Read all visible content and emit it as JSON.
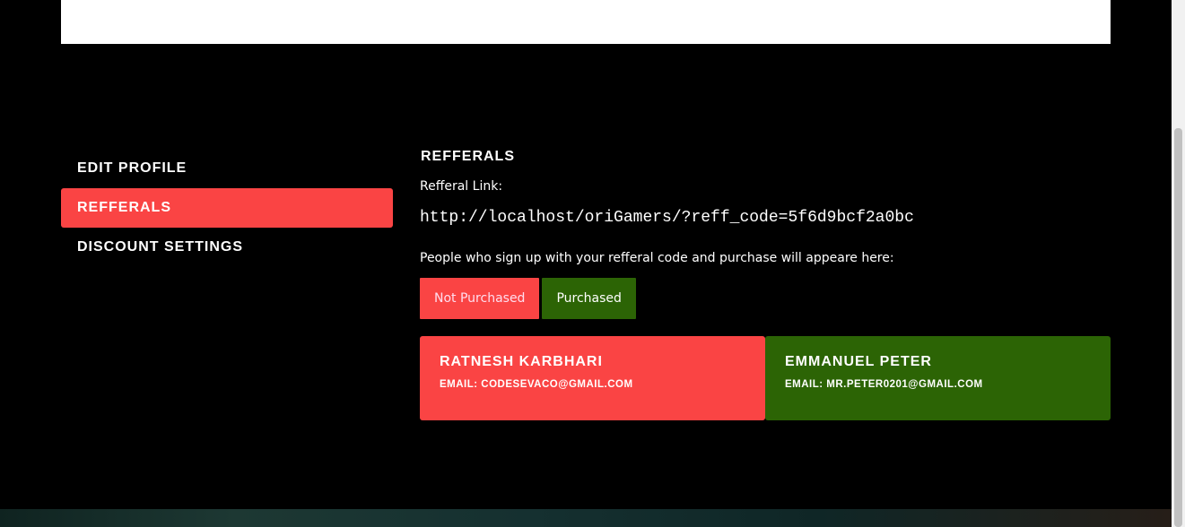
{
  "side_nav": {
    "items": [
      {
        "label": "Edit Profile"
      },
      {
        "label": "Refferals"
      },
      {
        "label": "Discount Settings"
      }
    ],
    "active_index": 1
  },
  "content": {
    "title": "Refferals",
    "referral_link_label": "Refferal Link:",
    "referral_link": "http://localhost/oriGamers/?reff_code=5f6d9bcf2a0bc",
    "people_text": "People who sign up with your refferal code and purchase will appeare here:",
    "tabs": {
      "not_purchased": "Not Purchased",
      "purchased": "Purchased"
    },
    "referrals": [
      {
        "name": "Ratnesh Karbhari",
        "email": "Email: codesevaco@gmail.com",
        "status": "not-purchased"
      },
      {
        "name": "Emmanuel Peter",
        "email": "Email: mr.peter0201@gmail.com",
        "status": "purchased"
      }
    ]
  },
  "colors": {
    "accent_red": "#fa4444",
    "accent_green": "#2c6405",
    "background": "#000000"
  }
}
